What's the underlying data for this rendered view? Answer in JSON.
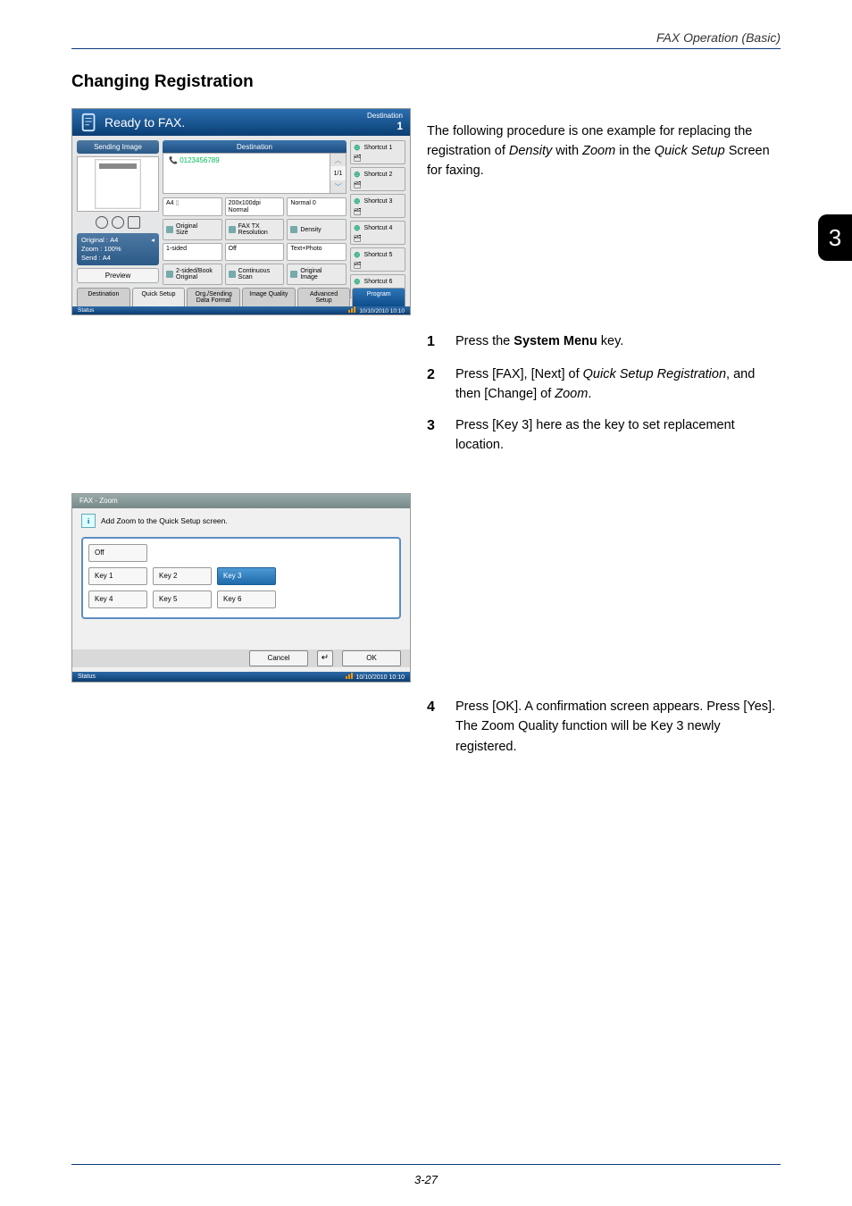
{
  "running_head": "FAX Operation (Basic)",
  "chapter_marker": "3",
  "section_title": "Changing Registration",
  "intro_p1": "The following procedure is one example for replacing the registration of ",
  "intro_em1": "Density",
  "intro_mid1": " with ",
  "intro_em2": "Zoom",
  "intro_mid2": " in the ",
  "intro_em3": "Quick Setup",
  "intro_tail": " Screen for faxing.",
  "steps": [
    {
      "num": "1",
      "pre": "Press the ",
      "bold": "System Menu",
      "post": " key."
    },
    {
      "num": "2",
      "pre": "Press [FAX], [Next] of ",
      "em": "Quick Setup Registration",
      "mid": ", and then [Change] of ",
      "em2": "Zoom",
      "post": "."
    },
    {
      "num": "3",
      "text": "Press [Key 3] here as the key to set replacement location."
    },
    {
      "num": "4",
      "text": "Press [OK]. A confirmation screen appears. Press [Yes]. The Zoom Quality function will be Key 3 newly registered."
    }
  ],
  "page_number": "3-27",
  "screen1": {
    "title": "Ready to FAX.",
    "title_right_top": "Destination",
    "title_right_num": "1",
    "sending_image": "Sending Image",
    "dest_header": "Destination",
    "dest_entry": "0123456789",
    "page_indicator": "1/1",
    "info": {
      "original_label": "Original",
      "original_val": "A4",
      "zoom_label": "Zoom",
      "zoom_val": "100%",
      "send_label": "Send",
      "send_val": "A4"
    },
    "preview_btn": "Preview",
    "row1": [
      "A4",
      "200x100dpi\nNormal",
      "Normal 0"
    ],
    "row2": [
      "Original\nSize",
      "FAX TX\nResolution",
      "Density"
    ],
    "row3": [
      "1-sided",
      "Off",
      "Text+Photo"
    ],
    "row4": [
      "2-sided/Book\nOriginal",
      "Continuous\nScan",
      "Original\nImage"
    ],
    "shortcuts": [
      "Shortcut 1",
      "Shortcut 2",
      "Shortcut 3",
      "Shortcut 4",
      "Shortcut 5",
      "Shortcut 6"
    ],
    "tabs": [
      "Destination",
      "Quick Setup",
      "Org./Sending\nData Format",
      "Image Quality",
      "Advanced\nSetup",
      "Program"
    ],
    "status_left": "Status",
    "status_right": "10/10/2010  10:10"
  },
  "screen2": {
    "title": "FAX - Zoom",
    "info_text": "Add Zoom to the Quick Setup screen.",
    "keys": [
      "Off",
      "Key 1",
      "Key 2",
      "Key 3",
      "Key 4",
      "Key 5",
      "Key 6"
    ],
    "selected_key": "Key 3",
    "cancel": "Cancel",
    "ok": "OK",
    "enter": "↵",
    "status_left": "Status",
    "status_right": "10/10/2010  10:10"
  }
}
